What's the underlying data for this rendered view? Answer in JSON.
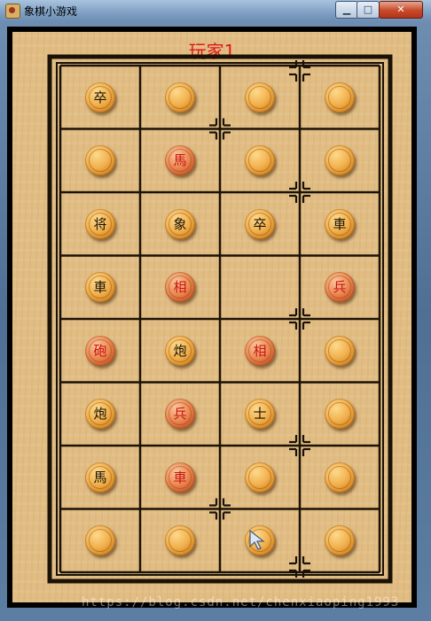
{
  "window": {
    "title": "象棋小游戏",
    "minimize_glyph": "▁",
    "maximize_glyph": "□",
    "close_glyph": "✕"
  },
  "game": {
    "current_player": "玩家1",
    "board_grid": {
      "columns": 4,
      "rows": 8
    },
    "pieces": [
      {
        "row": 0,
        "col": 0,
        "label": "卒",
        "side": "black",
        "face_up": true
      },
      {
        "row": 0,
        "col": 1,
        "label": "",
        "side": "",
        "face_up": false
      },
      {
        "row": 0,
        "col": 2,
        "label": "",
        "side": "",
        "face_up": false
      },
      {
        "row": 0,
        "col": 3,
        "label": "",
        "side": "",
        "face_up": false
      },
      {
        "row": 1,
        "col": 0,
        "label": "",
        "side": "",
        "face_up": false
      },
      {
        "row": 1,
        "col": 1,
        "label": "馬",
        "side": "red",
        "face_up": true
      },
      {
        "row": 1,
        "col": 2,
        "label": "",
        "side": "",
        "face_up": false
      },
      {
        "row": 1,
        "col": 3,
        "label": "",
        "side": "",
        "face_up": false
      },
      {
        "row": 2,
        "col": 0,
        "label": "将",
        "side": "black",
        "face_up": true
      },
      {
        "row": 2,
        "col": 1,
        "label": "象",
        "side": "black",
        "face_up": true
      },
      {
        "row": 2,
        "col": 2,
        "label": "卒",
        "side": "black",
        "face_up": true
      },
      {
        "row": 2,
        "col": 3,
        "label": "車",
        "side": "black",
        "face_up": true
      },
      {
        "row": 3,
        "col": 0,
        "label": "車",
        "side": "black",
        "face_up": true
      },
      {
        "row": 3,
        "col": 1,
        "label": "相",
        "side": "red",
        "face_up": true
      },
      {
        "row": 3,
        "col": 3,
        "label": "兵",
        "side": "red",
        "face_up": true
      },
      {
        "row": 4,
        "col": 0,
        "label": "砲",
        "side": "red",
        "face_up": true
      },
      {
        "row": 4,
        "col": 1,
        "label": "炮",
        "side": "black",
        "face_up": true
      },
      {
        "row": 4,
        "col": 2,
        "label": "相",
        "side": "red",
        "face_up": true
      },
      {
        "row": 4,
        "col": 3,
        "label": "",
        "side": "",
        "face_up": false
      },
      {
        "row": 5,
        "col": 0,
        "label": "炮",
        "side": "black",
        "face_up": true
      },
      {
        "row": 5,
        "col": 1,
        "label": "兵",
        "side": "red",
        "face_up": true
      },
      {
        "row": 5,
        "col": 2,
        "label": "士",
        "side": "black",
        "face_up": true
      },
      {
        "row": 5,
        "col": 3,
        "label": "",
        "side": "",
        "face_up": false
      },
      {
        "row": 6,
        "col": 0,
        "label": "馬",
        "side": "black",
        "face_up": true
      },
      {
        "row": 6,
        "col": 1,
        "label": "車",
        "side": "red",
        "face_up": true
      },
      {
        "row": 6,
        "col": 2,
        "label": "",
        "side": "",
        "face_up": false
      },
      {
        "row": 6,
        "col": 3,
        "label": "",
        "side": "",
        "face_up": false
      },
      {
        "row": 7,
        "col": 0,
        "label": "",
        "side": "",
        "face_up": false
      },
      {
        "row": 7,
        "col": 1,
        "label": "",
        "side": "",
        "face_up": false
      },
      {
        "row": 7,
        "col": 2,
        "label": "",
        "side": "",
        "face_up": false
      },
      {
        "row": 7,
        "col": 3,
        "label": "",
        "side": "",
        "face_up": false
      }
    ]
  },
  "colors": {
    "player_label": "#e01818",
    "red_piece_text": "#c9120c",
    "black_piece_text": "#1a1206",
    "grid_line": "#1b1206"
  },
  "watermark": "https://blog.csdn.net/chenxiaoping1993"
}
